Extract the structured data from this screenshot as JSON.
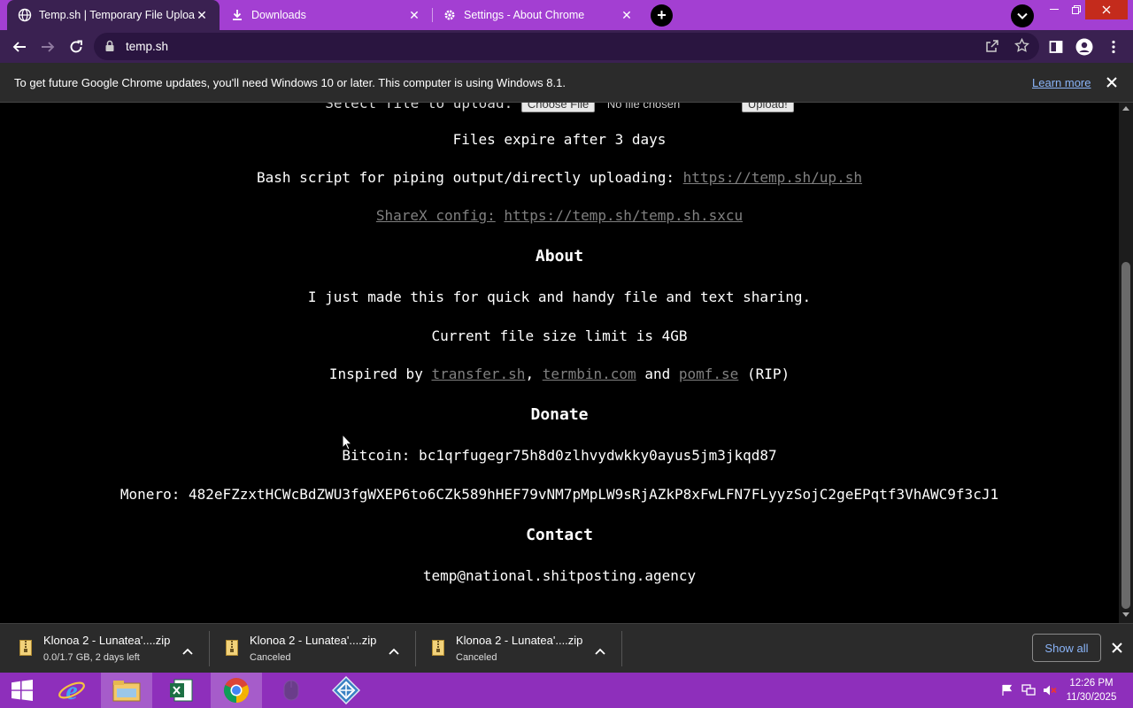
{
  "tabs": [
    {
      "title": "Temp.sh | Temporary File Upload",
      "icon": "globe-icon",
      "active": true
    },
    {
      "title": "Downloads",
      "icon": "download-icon",
      "active": false
    },
    {
      "title": "Settings - About Chrome",
      "icon": "gear-icon",
      "active": false
    }
  ],
  "toolbar": {
    "url": "temp.sh"
  },
  "infobar": {
    "message": "To get future Google Chrome updates, you'll need Windows 10 or later. This computer is using Windows 8.1.",
    "learn_more": "Learn more"
  },
  "page": {
    "upload_label": "Select file to upload:",
    "choose_file": "Choose File",
    "no_file": "No file chosen",
    "upload_button": "Upload!",
    "expire": "Files expire after 3 days",
    "bash_label": "Bash script for piping output/directly uploading:",
    "bash_link": "https://temp.sh/up.sh",
    "sharex_label": "ShareX config:",
    "sharex_link": "https://temp.sh/temp.sh.sxcu",
    "about_heading": "About",
    "about_text": "I just made this for quick and handy file and text sharing.",
    "size_limit": "Current file size limit is 4GB",
    "inspired_prefix": "Inspired by",
    "inspired_link1": "transfer.sh",
    "inspired_comma": ",",
    "inspired_link2": "termbin.com",
    "inspired_and": "and",
    "inspired_link3": "pomf.se",
    "inspired_suffix": "(RIP)",
    "donate_heading": "Donate",
    "bitcoin": "Bitcoin: bc1qrfugegr75h8d0zlhvydwkky0ayus5jm3jkqd87",
    "monero": "Monero: 482eFZzxtHCWcBdZWU3fgWXEP6to6CZk589hHEF79vNM7pMpLW9sRjAZkP8xFwLFN7FLyyzSojC2geEPqtf3VhAWC9f3cJ1",
    "contact_heading": "Contact",
    "contact_email": "temp@national.shitposting.agency"
  },
  "downloads": [
    {
      "name": "Klonoa 2 - Lunatea'....zip",
      "status": "0.0/1.7 GB, 2 days left"
    },
    {
      "name": "Klonoa 2 - Lunatea'....zip",
      "status": "Canceled"
    },
    {
      "name": "Klonoa 2 - Lunatea'....zip",
      "status": "Canceled"
    }
  ],
  "shelf": {
    "show_all": "Show all"
  },
  "taskbar": {
    "apps": [
      "windows-start-icon",
      "internet-explorer-icon",
      "file-explorer-icon",
      "excel-icon",
      "chrome-icon",
      "mouse-icon",
      "app-icon"
    ],
    "time": "12:26 PM",
    "date": "11/30/2025"
  },
  "colors": {
    "tabstrip": "#a33fd2",
    "toolbar": "#3a2151",
    "taskbar": "#8e2fbb",
    "link": "#808080",
    "accent_link": "#8ab4f8"
  }
}
